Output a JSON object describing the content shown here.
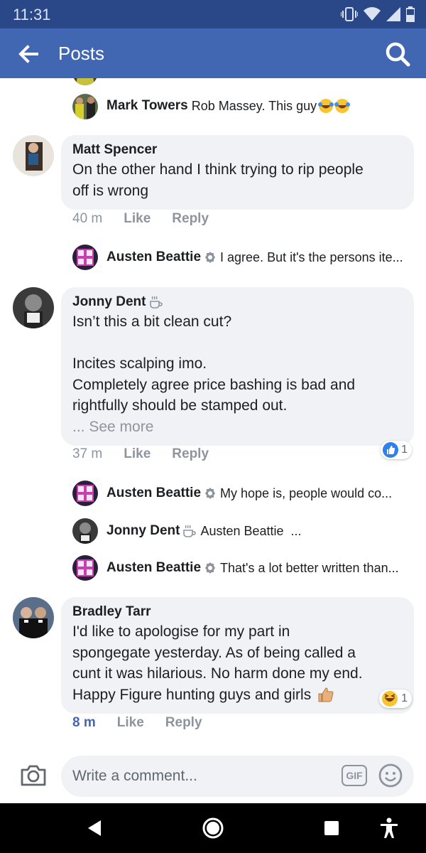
{
  "status_bar": {
    "time": "11:31"
  },
  "app_bar": {
    "title": "Posts"
  },
  "thread": {
    "top_reply": {
      "name": "Mark Towers",
      "text": "Rob Massey. This guy"
    },
    "comments": [
      {
        "author": "Matt Spencer",
        "text_lines": [
          "On the other hand I think trying to rip people",
          "off is wrong"
        ],
        "time": "40 m",
        "like": "Like",
        "reply": "Reply",
        "replies": [
          {
            "name": "Austen Beattie",
            "text": "I agree. But it's the persons ite..."
          }
        ]
      },
      {
        "author": "Jonny Dent",
        "text_lines": [
          "Isn’t this a bit clean cut?",
          "",
          "Incites scalping imo.",
          "Completely agree price bashing is bad and",
          "rightfully should be stamped out."
        ],
        "see_more": "... See more",
        "time": "37 m",
        "like": "Like",
        "reply": "Reply",
        "reaction_count": "1",
        "replies": [
          {
            "name": "Austen Beattie",
            "text": "My hope is, people would co..."
          },
          {
            "name": "Jonny Dent",
            "text": "Austen Beattie  ..."
          },
          {
            "name": "Austen Beattie",
            "text": "That's a lot better written than..."
          }
        ]
      },
      {
        "author": "Bradley Tarr",
        "text_lines": [
          "I'd like to apologise for my part in",
          "spongegate yesterday. As of being called a",
          "cunt it was hilarious. No harm done my end.",
          "Happy Figure hunting guys and girls"
        ],
        "time": "8 m",
        "like": "Like",
        "reply": "Reply",
        "reaction_count": "1"
      }
    ]
  },
  "composer": {
    "placeholder": "Write a comment...",
    "gif_label": "GIF"
  },
  "colors": {
    "brand": "#4267b2",
    "status_bar": "#2a4887",
    "bubble": "#f1f2f6",
    "muted": "#8d949e"
  },
  "icons": [
    "back-arrow-icon",
    "search-icon",
    "verified-badge-icon",
    "coffee-icon",
    "like-reaction-icon",
    "haha-reaction-icon",
    "thumbs-up-emoji-icon",
    "camera-icon",
    "gif-icon",
    "emoji-icon",
    "back-nav-icon",
    "home-nav-icon",
    "recents-nav-icon",
    "accessibility-icon"
  ]
}
